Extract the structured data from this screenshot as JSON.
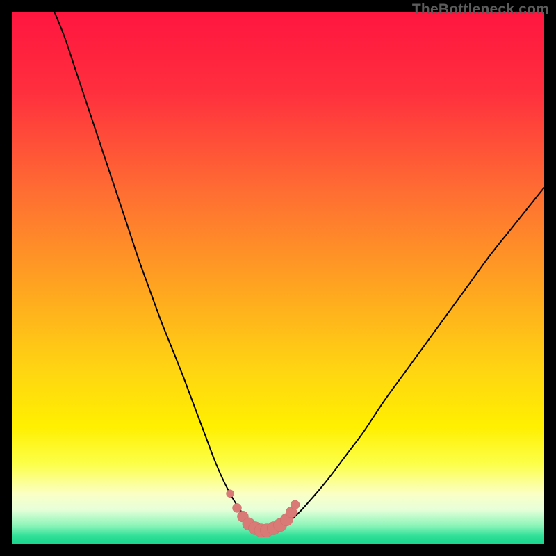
{
  "watermark": "TheBottleneck.com",
  "colors": {
    "black": "#000000",
    "gradient_stops": [
      {
        "offset": 0.0,
        "color": "#ff153f"
      },
      {
        "offset": 0.15,
        "color": "#ff2f3e"
      },
      {
        "offset": 0.33,
        "color": "#ff6b33"
      },
      {
        "offset": 0.5,
        "color": "#ff9f22"
      },
      {
        "offset": 0.67,
        "color": "#ffd412"
      },
      {
        "offset": 0.78,
        "color": "#fff000"
      },
      {
        "offset": 0.85,
        "color": "#fcff4a"
      },
      {
        "offset": 0.905,
        "color": "#fbffc4"
      },
      {
        "offset": 0.935,
        "color": "#e6ffd9"
      },
      {
        "offset": 0.965,
        "color": "#8cf5b9"
      },
      {
        "offset": 0.985,
        "color": "#2fdf97"
      },
      {
        "offset": 1.0,
        "color": "#18d68e"
      }
    ],
    "curve": "#000000",
    "marker_fill": "#d97a77",
    "marker_stroke": "#c96a67"
  },
  "chart_data": {
    "type": "line",
    "title": "",
    "xlabel": "",
    "ylabel": "",
    "xlim": [
      0,
      100
    ],
    "ylim": [
      0,
      100
    ],
    "series": [
      {
        "name": "bottleneck-curve",
        "x": [
          8,
          10,
          12,
          14,
          16,
          18,
          20,
          22,
          24,
          26,
          28,
          30,
          32,
          33.5,
          35,
          36.5,
          38,
          39.5,
          41,
          42.5,
          44,
          45,
          46,
          47,
          48,
          50,
          52,
          54,
          56,
          58,
          60,
          63,
          66,
          70,
          74,
          78,
          82,
          86,
          90,
          94,
          98,
          100
        ],
        "y": [
          100,
          95,
          89,
          83,
          77,
          71,
          65,
          59,
          53,
          47.5,
          42,
          37,
          32,
          28,
          24,
          20,
          16,
          12.5,
          9.5,
          7,
          5,
          3.8,
          3.0,
          2.6,
          2.6,
          3.0,
          4.2,
          6.0,
          8.2,
          10.5,
          13,
          17,
          21,
          27,
          32.5,
          38,
          43.5,
          49,
          54.5,
          59.5,
          64.5,
          67
        ]
      }
    ],
    "markers": {
      "name": "highlight-dots",
      "x": [
        41.0,
        42.3,
        43.4,
        44.5,
        45.7,
        46.8,
        47.9,
        49.2,
        50.4,
        51.6,
        52.5,
        53.2
      ],
      "y": [
        9.5,
        6.8,
        5.2,
        3.8,
        3.0,
        2.6,
        2.6,
        3.0,
        3.6,
        4.6,
        6.0,
        7.4
      ],
      "r": [
        5.5,
        6.5,
        8.0,
        9.0,
        9.5,
        9.5,
        9.5,
        9.5,
        9.5,
        9.0,
        8.0,
        6.5
      ]
    }
  }
}
